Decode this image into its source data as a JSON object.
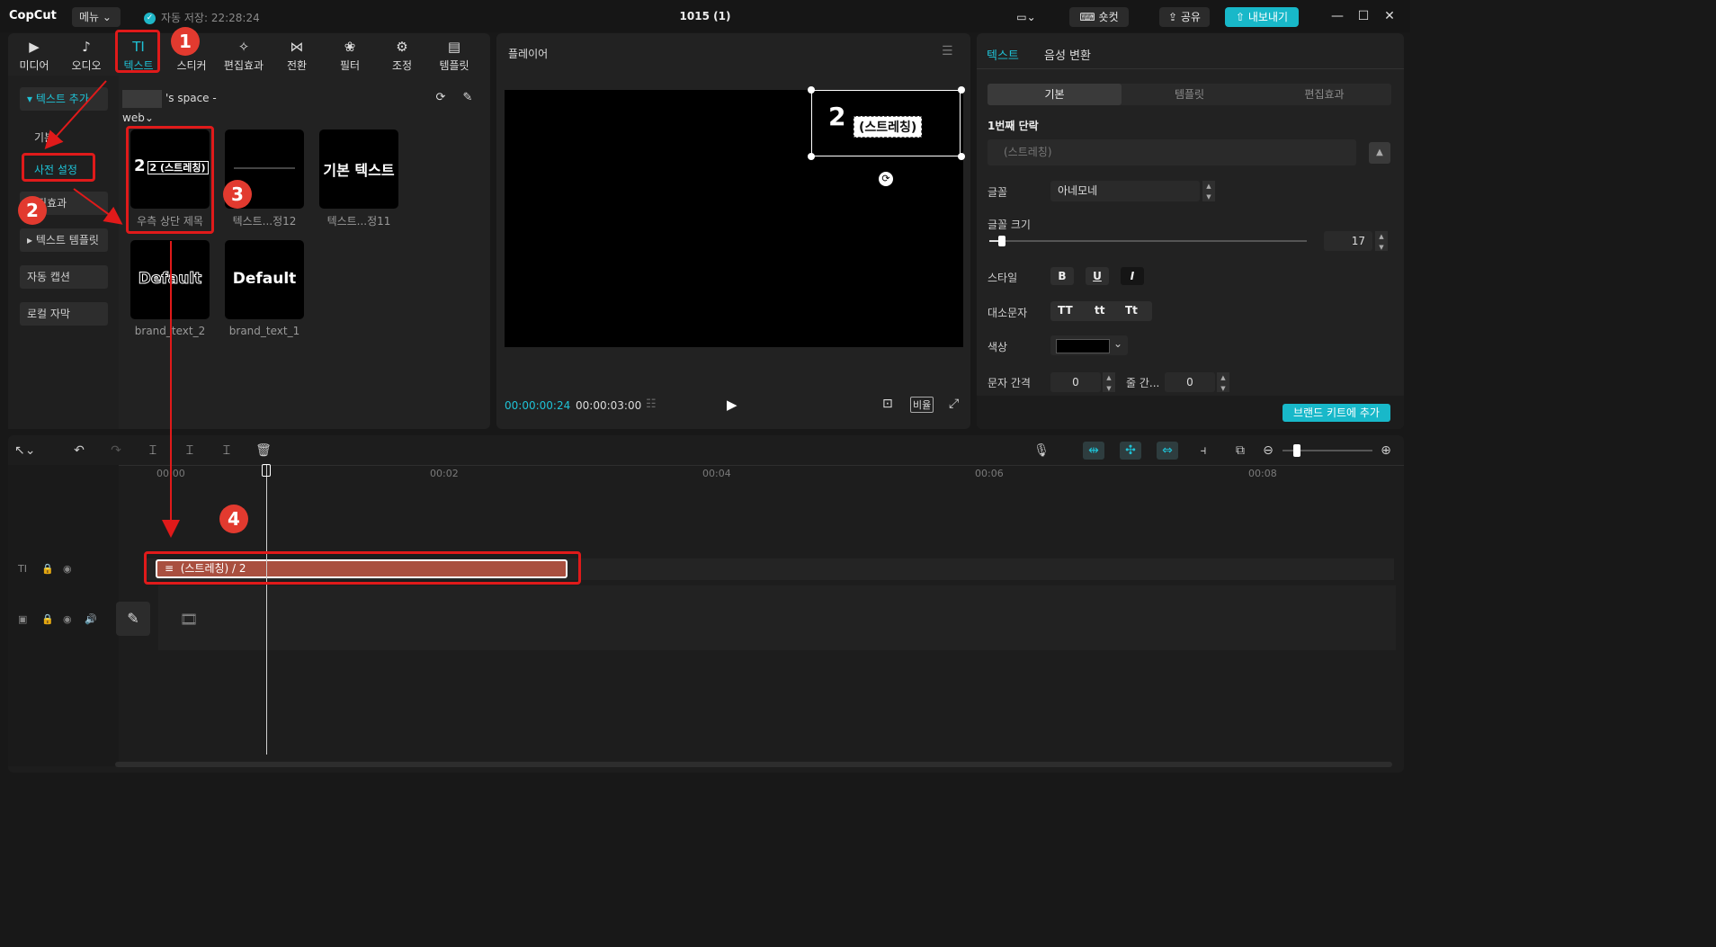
{
  "app": {
    "logo": "CopCut",
    "menu_label": "메뉴",
    "autosave": "자동 저장: 22:28:24",
    "project_title": "1015 (1)",
    "shortcut_label": "숏컷",
    "share_label": "공유",
    "export_label": "내보내기"
  },
  "categories": [
    {
      "label": "미디어",
      "icon": "media-icon"
    },
    {
      "label": "오디오",
      "icon": "audio-icon"
    },
    {
      "label": "텍스트",
      "icon": "text-icon",
      "active": true
    },
    {
      "label": "스티커",
      "icon": "sticker-icon"
    },
    {
      "label": "편집효과",
      "icon": "effects-icon"
    },
    {
      "label": "전환",
      "icon": "transition-icon"
    },
    {
      "label": "필터",
      "icon": "filter-icon"
    },
    {
      "label": "조정",
      "icon": "adjust-icon"
    },
    {
      "label": "템플릿",
      "icon": "template-icon"
    }
  ],
  "left_nav": {
    "add_text": "▾ 텍스트 추가",
    "basic": "기본",
    "preset": "사전 설정",
    "effects": "편집효과",
    "text_template": "▸ 텍스트 템플릿",
    "auto_caption": "자동 캡션",
    "local_caption": "로컬 자막"
  },
  "space_selector": "'s space - web",
  "tiles": [
    {
      "preview": "2 (스트레칭)",
      "caption": "우측 상단 제목"
    },
    {
      "preview": "",
      "caption": "텍스트...정12"
    },
    {
      "preview": "기본 텍스트",
      "caption": "텍스트...정11"
    },
    {
      "preview": "Default",
      "caption": "brand_text_2"
    },
    {
      "preview": "Default",
      "caption": "brand_text_1"
    }
  ],
  "player": {
    "title": "플레이어",
    "overlay_number": "2",
    "overlay_text": "(스트레칭)",
    "time_current": "00:00:00:24",
    "time_total": "00:00:03:00",
    "ratio_label": "비율"
  },
  "inspector": {
    "tabs": [
      "텍스트",
      "음성 변환"
    ],
    "segments": [
      "기본",
      "템플릿",
      "편집효과"
    ],
    "paragraph_label": "1번째 단락",
    "paragraph_value": "(스트레칭)",
    "font_label": "글꼴",
    "font_value": "아네모네",
    "size_label": "글꼴 크기",
    "size_value": "17",
    "size_fraction": 0.04,
    "style_label": "스타일",
    "style_buttons": [
      "B",
      "U",
      "I"
    ],
    "case_label": "대소문자",
    "case_buttons": [
      "TT",
      "tt",
      "Tt"
    ],
    "color_label": "색상",
    "spacing_label": "문자 간격",
    "spacing_value": "0",
    "line_label": "줄 간...",
    "line_value": "0",
    "brand_button": "브랜드 키트에 추가"
  },
  "timeline": {
    "ruler": [
      "00:00",
      "00:02",
      "00:04",
      "00:06",
      "00:08"
    ],
    "clip_label": "(스트레칭)  / 2"
  },
  "annotations": [
    "1",
    "2",
    "3",
    "4"
  ],
  "colors": {
    "accent": "#18b8c9",
    "clip": "#a94f3f",
    "annotation": "#e01a1a"
  }
}
